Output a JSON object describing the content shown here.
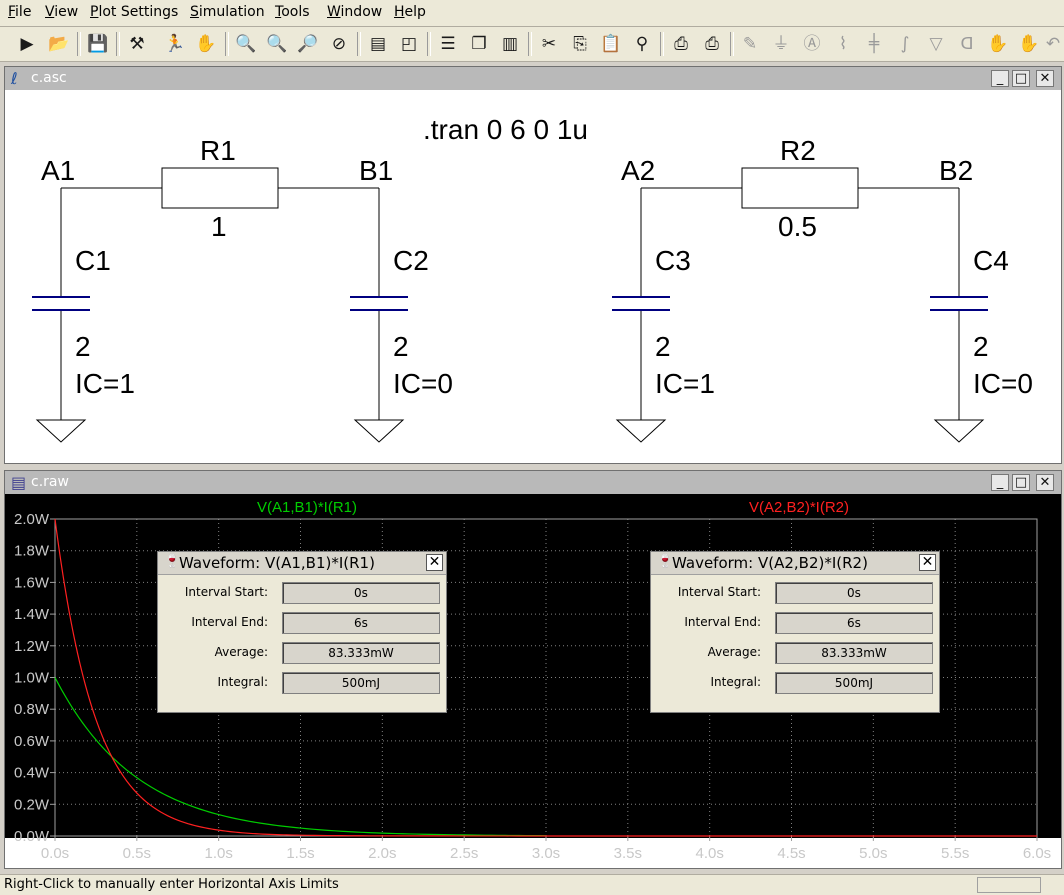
{
  "menu": [
    "File",
    "View",
    "Plot Settings",
    "Simulation",
    "Tools",
    "Window",
    "Help"
  ],
  "toolbar_icons": [
    "run-icon",
    "open-icon",
    "save-icon",
    "control-panel-icon",
    "run-stop-icon",
    "pan-hand-icon",
    "zoom-in-icon",
    "zoom-area-icon",
    "zoom-out-icon",
    "zoom-cancel-icon",
    "autorange-icon",
    "view-fit-icon",
    "tile-horizontal-icon",
    "cascade-icon",
    "tile-vertical-icon",
    "cut-icon",
    "copy-icon",
    "paste-icon",
    "find-icon",
    "print-icon",
    "print-setup-icon",
    "wire-icon",
    "ground-icon",
    "label-icon",
    "resistor-icon",
    "capacitor-icon",
    "inductor-icon",
    "diode-icon",
    "component-icon",
    "move-hand-icon",
    "drag-hand-icon",
    "undo-icon"
  ],
  "schematic_window": {
    "title": "c.asc",
    "directive": ".tran 0 6 0 1u",
    "nodes": [
      "A1",
      "B1",
      "A2",
      "B2"
    ],
    "resistors": [
      {
        "name": "R1",
        "value": "1"
      },
      {
        "name": "R2",
        "value": "0.5"
      }
    ],
    "capacitors": [
      {
        "name": "C1",
        "value": "2",
        "ic": "IC=1"
      },
      {
        "name": "C2",
        "value": "2",
        "ic": "IC=0"
      },
      {
        "name": "C3",
        "value": "2",
        "ic": "IC=1"
      },
      {
        "name": "C4",
        "value": "2",
        "ic": "IC=0"
      }
    ]
  },
  "plot_window": {
    "title": "c.raw"
  },
  "chart_data": {
    "type": "line",
    "x_ticks": [
      "0.0s",
      "0.5s",
      "1.0s",
      "1.5s",
      "2.0s",
      "2.5s",
      "3.0s",
      "3.5s",
      "4.0s",
      "4.5s",
      "5.0s",
      "5.5s",
      "6.0s"
    ],
    "y_ticks": [
      "0.0W",
      "0.2W",
      "0.4W",
      "0.6W",
      "0.8W",
      "1.0W",
      "1.2W",
      "1.4W",
      "1.6W",
      "1.8W",
      "2.0W"
    ],
    "xlim": [
      0,
      6
    ],
    "ylim": [
      0,
      2
    ],
    "grid": true,
    "series": [
      {
        "name": "V(A1,B1)*I(R1)",
        "color": "#00cc00",
        "x": [
          0,
          0.25,
          0.5,
          0.75,
          1,
          1.25,
          1.5,
          2,
          2.5,
          3
        ],
        "y": [
          1.0,
          0.607,
          0.368,
          0.223,
          0.135,
          0.082,
          0.05,
          0.018,
          0.007,
          0.002
        ]
      },
      {
        "name": "V(A2,B2)*I(R2)",
        "color": "#ff2020",
        "x": [
          0,
          0.1,
          0.25,
          0.5,
          0.75,
          1,
          1.25,
          1.5,
          2,
          3,
          6
        ],
        "y": [
          2.0,
          1.341,
          0.736,
          0.271,
          0.1,
          0.037,
          0.013,
          0.005,
          0.001,
          0,
          0
        ]
      }
    ]
  },
  "dialogs": [
    {
      "title": "Waveform: V(A1,B1)*I(R1)",
      "interval_start_label": "Interval Start:",
      "interval_start": "0s",
      "interval_end_label": "Interval End:",
      "interval_end": "6s",
      "average_label": "Average:",
      "average": "83.333mW",
      "integral_label": "Integral:",
      "integral": "500mJ"
    },
    {
      "title": "Waveform: V(A2,B2)*I(R2)",
      "interval_start_label": "Interval Start:",
      "interval_start": "0s",
      "interval_end_label": "Interval End:",
      "interval_end": "6s",
      "average_label": "Average:",
      "average": "83.333mW",
      "integral_label": "Integral:",
      "integral": "500mJ"
    }
  ],
  "status_text": "Right-Click to manually enter Horizontal Axis Limits"
}
